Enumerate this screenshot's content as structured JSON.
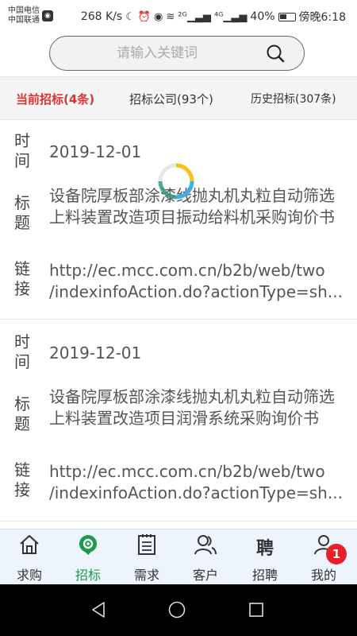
{
  "statusbar": {
    "carrier1": "中国电信",
    "carrier2": "中国联通",
    "speed": "268 K/s",
    "signal1": "²ᴳ",
    "signal2": "⁴ᴳ",
    "battery": "40%",
    "time": "傍晚6:18"
  },
  "search": {
    "placeholder": "请输入关键词"
  },
  "tabs": [
    {
      "label": "当前招标(4条)",
      "active": true
    },
    {
      "label": "招标公司(93个)",
      "active": false
    },
    {
      "label": "历史招标(307条)",
      "active": false
    }
  ],
  "labels": {
    "time": "时间",
    "title": "标题",
    "link": "链接"
  },
  "items": [
    {
      "date": "2019-12-01",
      "title": "设备院厚板部涂漆线抛丸机丸粒自动筛选上料装置改造项目振动给料机采购询价书",
      "link_line1": "http://ec.mcc.com.cn/b2b/web/two",
      "link_line2": "/indexinfoAction.do?actionType=sh..."
    },
    {
      "date": "2019-12-01",
      "title": "设备院厚板部涂漆线抛丸机丸粒自动筛选上料装置改造项目润滑系统采购询价书",
      "link_line1": "http://ec.mcc.com.cn/b2b/web/two",
      "link_line2": "/indexinfoAction.do?actionType=sh..."
    }
  ],
  "nav": [
    {
      "label": "求购",
      "icon": "home-icon"
    },
    {
      "label": "招标",
      "icon": "bid-icon",
      "active": true
    },
    {
      "label": "需求",
      "icon": "clipboard-icon"
    },
    {
      "label": "客户",
      "icon": "customers-icon"
    },
    {
      "label": "招聘",
      "icon": "recruit-icon",
      "glyph": "聘"
    },
    {
      "label": "我的",
      "icon": "profile-icon",
      "badge": "1"
    }
  ],
  "colors": {
    "active_tab": "#dd3333",
    "active_nav": "#1a9b4b",
    "badge": "#e8202a",
    "nav_bg": "#edf4fb"
  }
}
